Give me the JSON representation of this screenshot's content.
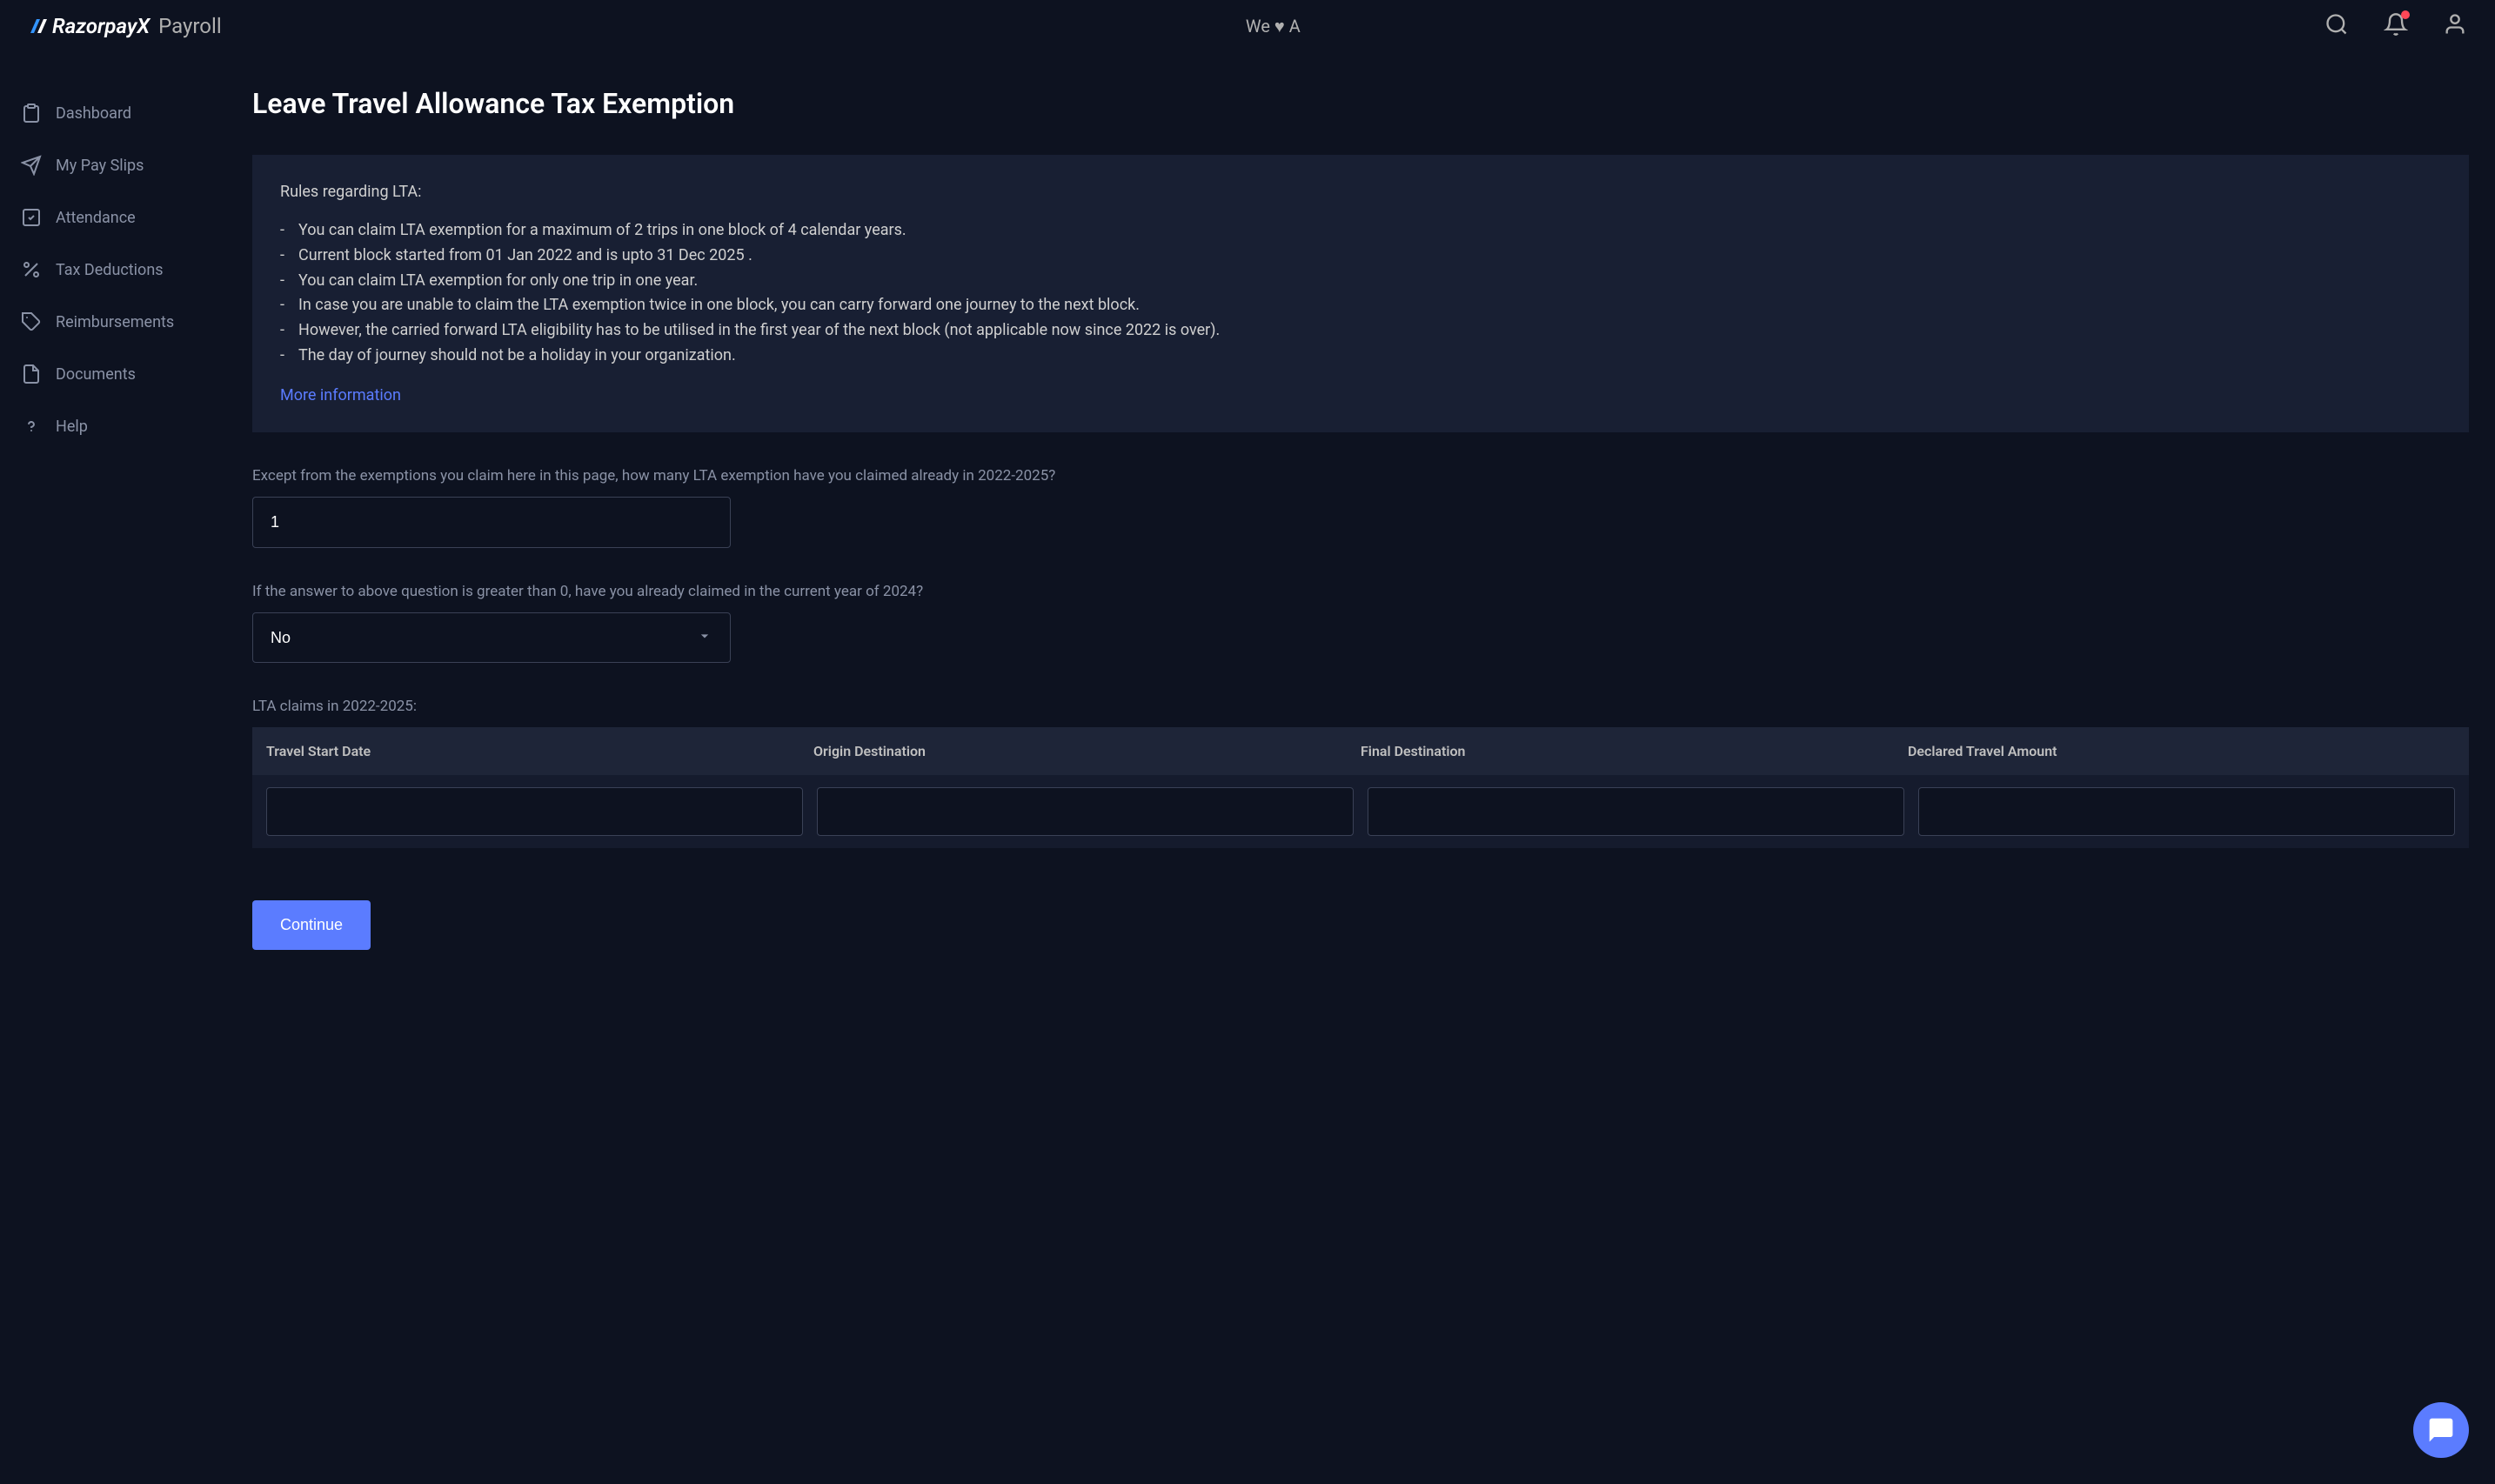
{
  "header": {
    "logo_main": "RazorpayX",
    "logo_sub": "Payroll",
    "org_text": "We ♥ A"
  },
  "sidebar": {
    "items": [
      {
        "label": "Dashboard"
      },
      {
        "label": "My Pay Slips"
      },
      {
        "label": "Attendance"
      },
      {
        "label": "Tax Deductions"
      },
      {
        "label": "Reimbursements"
      },
      {
        "label": "Documents"
      },
      {
        "label": "Help"
      }
    ]
  },
  "page": {
    "title": "Leave Travel Allowance Tax Exemption"
  },
  "rules": {
    "heading": "Rules regarding LTA:",
    "items": [
      "You can claim LTA exemption for a maximum of 2 trips in one block of 4 calendar years.",
      "Current block started from 01 Jan 2022 and is upto 31 Dec 2025 .",
      "You can claim LTA exemption for only one trip in one year.",
      "In case you are unable to claim the LTA exemption twice in one block, you can carry forward one journey to the next block.",
      "However, the carried forward LTA eligibility has to be utilised in the first year of the next block (not applicable now since 2022 is over).",
      "The day of journey should not be a holiday in your organization."
    ],
    "more_label": "More information"
  },
  "form": {
    "q1_label": "Except from the exemptions you claim here in this page, how many LTA exemption have you claimed already in 2022-2025?",
    "q1_value": "1",
    "q2_label": "If the answer to above question is greater than 0, have you already claimed in the current year of 2024?",
    "q2_value": "No"
  },
  "claims": {
    "heading": "LTA claims in 2022-2025:",
    "columns": [
      "Travel Start Date",
      "Origin Destination",
      "Final Destination",
      "Declared Travel Amount"
    ],
    "rows": [
      {
        "start_date": "",
        "origin": "",
        "final": "",
        "amount": ""
      }
    ]
  },
  "actions": {
    "continue_label": "Continue"
  }
}
